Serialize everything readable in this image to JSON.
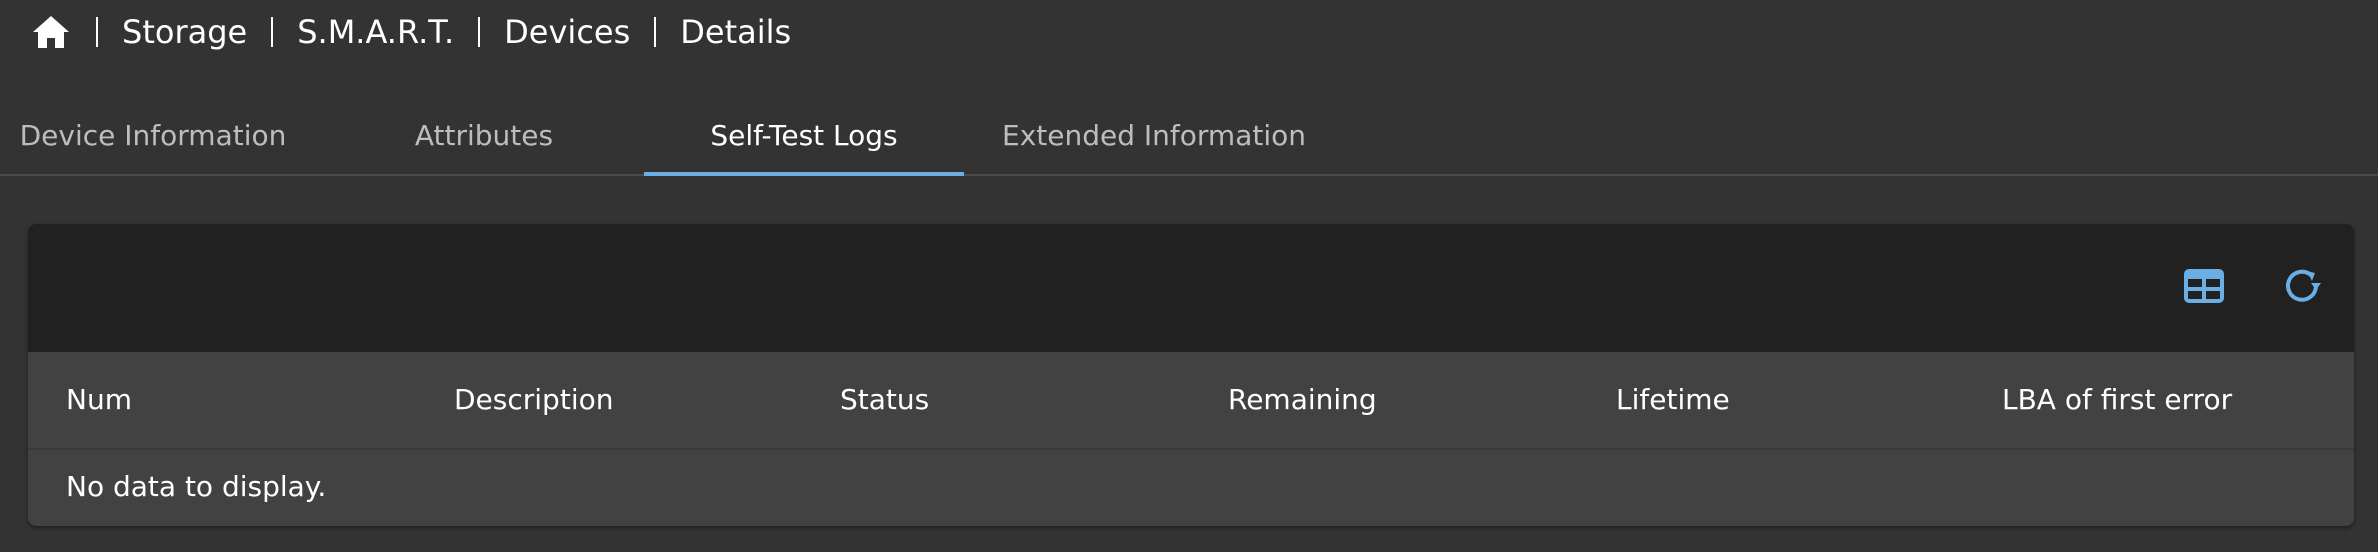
{
  "breadcrumb": {
    "items": [
      "Storage",
      "S.M.A.R.T.",
      "Devices",
      "Details"
    ]
  },
  "tabs": [
    {
      "label": "Device Information",
      "active": false
    },
    {
      "label": "Attributes",
      "active": false
    },
    {
      "label": "Self-Test Logs",
      "active": true
    },
    {
      "label": "Extended Information",
      "active": false
    }
  ],
  "table": {
    "columns": [
      "Num",
      "Description",
      "Status",
      "Remaining",
      "Lifetime",
      "LBA of first error"
    ],
    "empty_message": "No data to display."
  },
  "toolbar": {
    "icons": [
      "table-columns-icon",
      "refresh-icon"
    ]
  },
  "colors": {
    "accent": "#6aaee3",
    "background": "#333333",
    "toolbar": "#212121",
    "table": "#424242"
  }
}
